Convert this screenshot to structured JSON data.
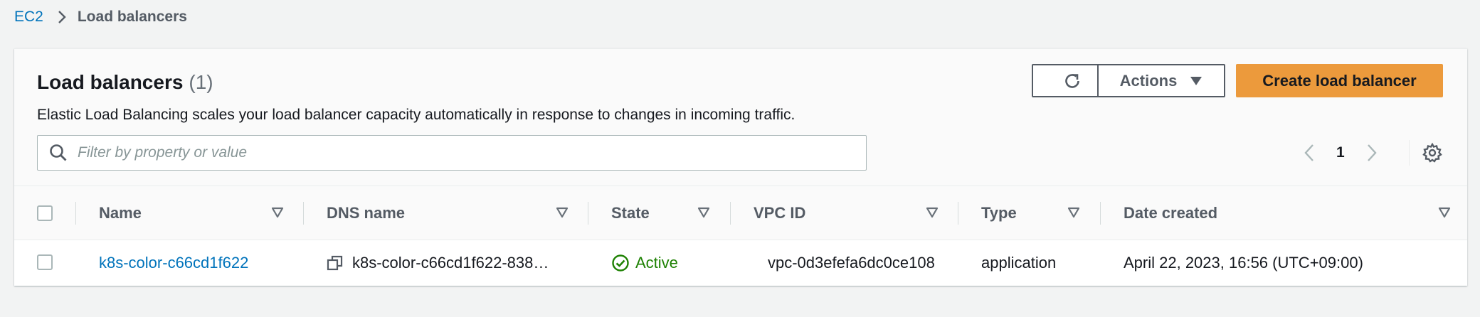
{
  "breadcrumb": {
    "items": [
      {
        "label": "EC2"
      },
      {
        "label": "Load balancers"
      }
    ]
  },
  "panel": {
    "title": "Load balancers",
    "count": "(1)",
    "description": "Elastic Load Balancing scales your load balancer capacity automatically in response to changes in incoming traffic.",
    "buttons": {
      "refresh_icon": "refresh-icon",
      "actions_label": "Actions",
      "create_label": "Create load balancer"
    },
    "search": {
      "placeholder": "Filter by property or value",
      "value": ""
    },
    "pagination": {
      "current_page": "1"
    }
  },
  "table": {
    "columns": [
      {
        "label": "Name"
      },
      {
        "label": "DNS name"
      },
      {
        "label": "State"
      },
      {
        "label": "VPC ID"
      },
      {
        "label": "Type"
      },
      {
        "label": "Date created"
      }
    ],
    "rows": [
      {
        "name": "k8s-color-c66cd1f622",
        "dns_name": "k8s-color-c66cd1f622-838…",
        "state": "Active",
        "vpc_id": "vpc-0d3efefa6dc0ce108",
        "type": "application",
        "date_created": "April 22, 2023, 16:56 (UTC+09:00)"
      }
    ]
  },
  "colors": {
    "link": "#0073bb",
    "primary_button": "#ec9a3c",
    "status_active": "#1d8102",
    "background": "#f2f3f3"
  }
}
